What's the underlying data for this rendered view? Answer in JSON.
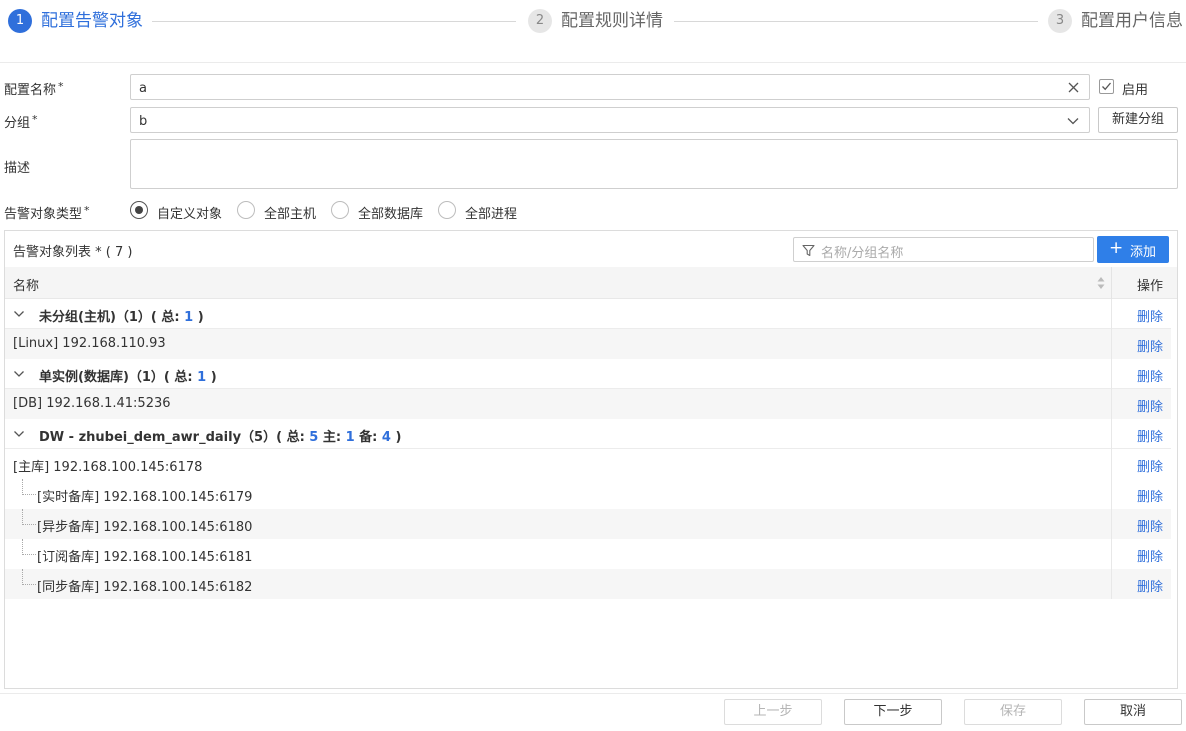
{
  "steps": [
    {
      "num": "1",
      "label": "配置告警对象"
    },
    {
      "num": "2",
      "label": "配置规则详情"
    },
    {
      "num": "3",
      "label": "配置用户信息"
    }
  ],
  "form": {
    "name_label": "配置名称",
    "name_value": "a",
    "enable_label": "启用",
    "group_label": "分组",
    "group_value": "b",
    "new_group_button": "新建分组",
    "desc_label": "描述",
    "desc_value": "",
    "type_label": "告警对象类型",
    "required_mark": "*",
    "type_options": [
      "自定义对象",
      "全部主机",
      "全部数据库",
      "全部进程"
    ],
    "type_selected": "自定义对象"
  },
  "panel": {
    "title": "告警对象列表 * ( 7 )",
    "filter_placeholder": "名称/分组名称",
    "add_button": "添加",
    "col_name": "名称",
    "col_op": "操作",
    "delete_label": "删除",
    "rows": [
      {
        "kind": "group",
        "prefix": "未分组(主机)（1）( 总: ",
        "total": "1",
        "suffix": " )"
      },
      {
        "kind": "item",
        "text": "[Linux] 192.168.110.93"
      },
      {
        "kind": "group",
        "prefix": "单实例(数据库)（1）( 总: ",
        "total": "1",
        "suffix": " )"
      },
      {
        "kind": "item",
        "text": "[DB] 192.168.1.41:5236"
      },
      {
        "kind": "group",
        "prefix": "DW - zhubei_dem_awr_daily（5）( 总: ",
        "total": "5",
        "primary_label": " 主: ",
        "primary": "1",
        "standby_label": " 备: ",
        "standby": "4",
        "suffix": " )"
      },
      {
        "kind": "item",
        "text": "[主库] 192.168.100.145:6178"
      },
      {
        "kind": "child",
        "text": "[实时备库] 192.168.100.145:6179"
      },
      {
        "kind": "child",
        "text": "[异步备库] 192.168.100.145:6180"
      },
      {
        "kind": "child",
        "text": "[订阅备库] 192.168.100.145:6181"
      },
      {
        "kind": "child",
        "text": "[同步备库] 192.168.100.145:6182"
      }
    ]
  },
  "footer": {
    "prev": "上一步",
    "next": "下一步",
    "save": "保存",
    "cancel": "取消"
  },
  "colors": {
    "accent": "#2f6fdb",
    "add_button": "#2f7fe8"
  }
}
